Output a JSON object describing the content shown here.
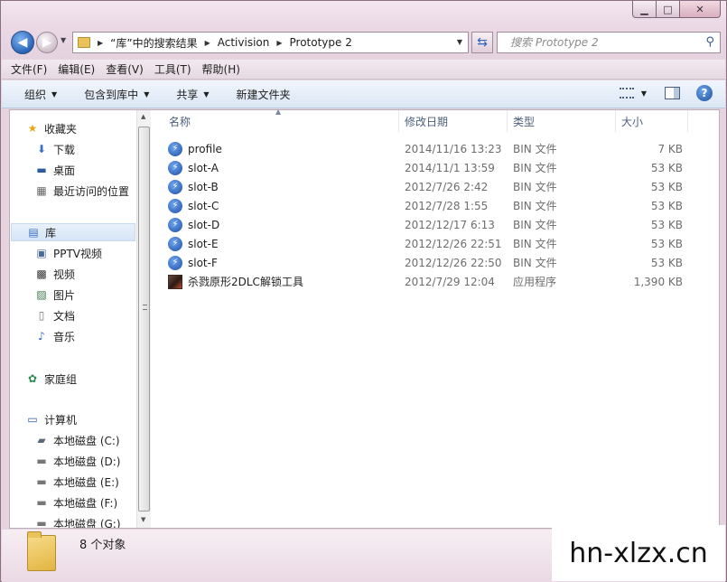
{
  "window": {
    "caption_buttons": {
      "minimize": "▁",
      "maximize": "□",
      "close": "✕"
    }
  },
  "address_bar": {
    "breadcrumbs": [
      "“库”中的搜索结果",
      "Activision",
      "Prototype 2"
    ],
    "search_placeholder": "搜索 Prototype 2"
  },
  "menu": [
    "文件(F)",
    "编辑(E)",
    "查看(V)",
    "工具(T)",
    "帮助(H)"
  ],
  "toolbar": {
    "organize": "组织",
    "include_in_library": "包含到库中",
    "share": "共享",
    "new_folder": "新建文件夹"
  },
  "nav_pane": {
    "favorites": {
      "label": "收藏夹",
      "items": [
        "下载",
        "桌面",
        "最近访问的位置"
      ]
    },
    "libraries": {
      "label": "库",
      "items": [
        "PPTV视频",
        "视频",
        "图片",
        "文档",
        "音乐"
      ]
    },
    "homegroup": {
      "label": "家庭组"
    },
    "computer": {
      "label": "计算机",
      "items": [
        "本地磁盘 (C:)",
        "本地磁盘 (D:)",
        "本地磁盘 (E:)",
        "本地磁盘 (F:)",
        "本地磁盘 (G:)"
      ]
    }
  },
  "columns": {
    "name": "名称",
    "date": "修改日期",
    "type": "类型",
    "size": "大小"
  },
  "files": [
    {
      "name": "profile",
      "date": "2014/11/16 13:23",
      "type": "BIN 文件",
      "size": "7 KB",
      "icon": "bin-file-icon"
    },
    {
      "name": "slot-A",
      "date": "2014/11/1 13:59",
      "type": "BIN 文件",
      "size": "53 KB",
      "icon": "bin-file-icon"
    },
    {
      "name": "slot-B",
      "date": "2012/7/26 2:42",
      "type": "BIN 文件",
      "size": "53 KB",
      "icon": "bin-file-icon"
    },
    {
      "name": "slot-C",
      "date": "2012/7/28 1:55",
      "type": "BIN 文件",
      "size": "53 KB",
      "icon": "bin-file-icon"
    },
    {
      "name": "slot-D",
      "date": "2012/12/17 6:13",
      "type": "BIN 文件",
      "size": "53 KB",
      "icon": "bin-file-icon"
    },
    {
      "name": "slot-E",
      "date": "2012/12/26 22:51",
      "type": "BIN 文件",
      "size": "53 KB",
      "icon": "bin-file-icon"
    },
    {
      "name": "slot-F",
      "date": "2012/12/26 22:50",
      "type": "BIN 文件",
      "size": "53 KB",
      "icon": "bin-file-icon"
    },
    {
      "name": "杀戮原形2DLC解锁工具",
      "date": "2012/7/29 12:04",
      "type": "应用程序",
      "size": "1,390 KB",
      "icon": "app-icon"
    }
  ],
  "status": {
    "count_text": "8 个对象"
  },
  "watermark": "hn-xlzx.cn"
}
